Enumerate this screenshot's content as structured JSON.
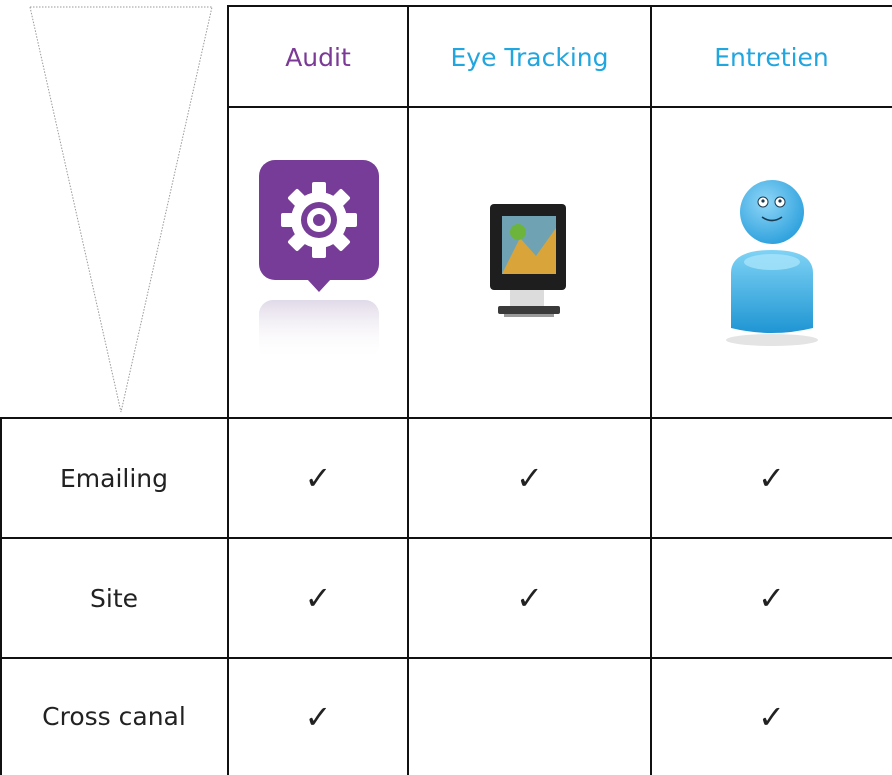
{
  "colors": {
    "audit": "#7B3A96",
    "eye_tracking": "#21A6E0",
    "entretien": "#21A6E0",
    "text": "#222222",
    "grid": "#111111"
  },
  "columns": [
    {
      "label": "Audit",
      "icon": "gear-speech-bubble-icon"
    },
    {
      "label": "Eye Tracking",
      "icon": "computer-monitor-icon"
    },
    {
      "label": "Entretien",
      "icon": "smiling-user-avatar-icon"
    }
  ],
  "check_glyph": "✓",
  "rows": [
    {
      "label": "Emailing",
      "audit": true,
      "eye_tracking": true,
      "entretien": true
    },
    {
      "label": "Site",
      "audit": true,
      "eye_tracking": true,
      "entretien": true
    },
    {
      "label": "Cross canal",
      "audit": true,
      "eye_tracking": false,
      "entretien": true
    }
  ]
}
